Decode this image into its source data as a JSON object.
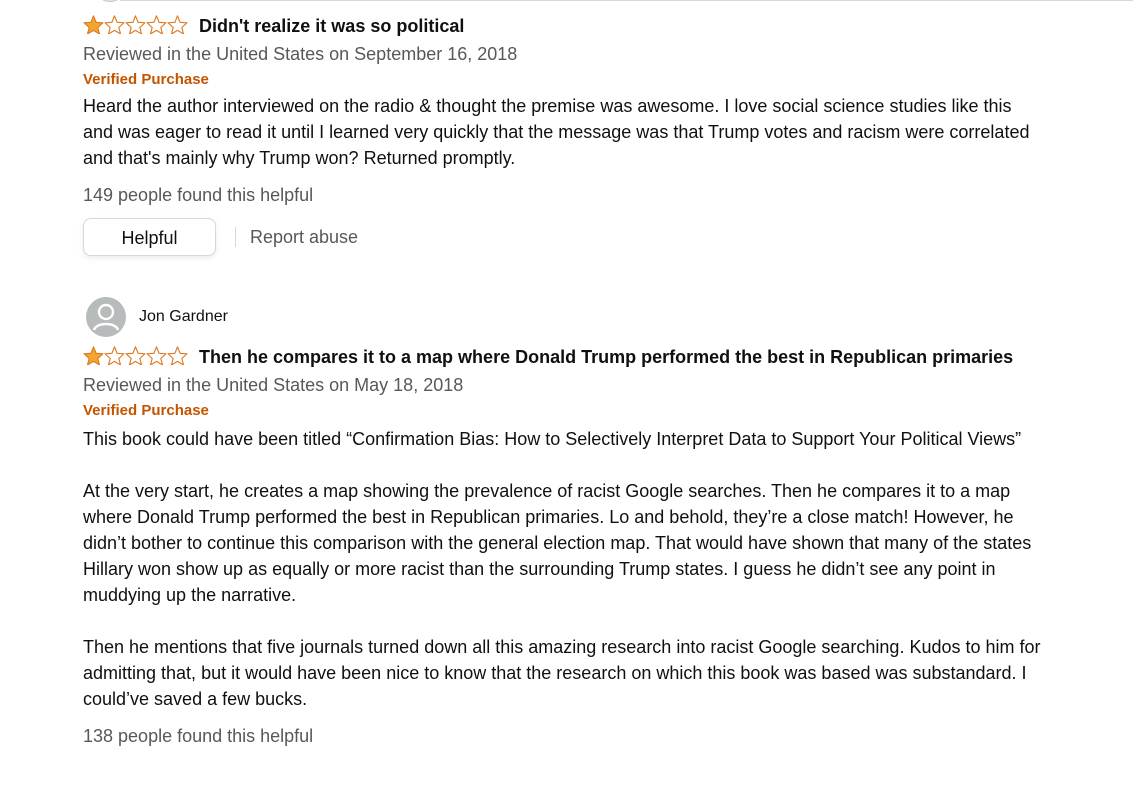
{
  "reviews": [
    {
      "reviewer": "",
      "rating": 1,
      "title": "Didn't realize it was so political",
      "meta": "Reviewed in the United States on September 16, 2018",
      "verified": "Verified Purchase",
      "body": [
        "Heard the author interviewed on the radio & thought the premise was awesome. I love social science studies like this and was eager to read it until I learned very quickly that the message was that Trump votes and racism were correlated and that's mainly why Trump won? Returned promptly."
      ],
      "helpful_count": "149 people found this helpful",
      "helpful_button": "Helpful",
      "report_label": "Report abuse"
    },
    {
      "reviewer": "Jon Gardner",
      "rating": 1,
      "title": "Then he compares it to a map where Donald Trump performed the best in Republican primaries",
      "meta": "Reviewed in the United States on May 18, 2018",
      "verified": "Verified Purchase",
      "body": [
        "This book could have been titled “Confirmation Bias: How to Selectively Interpret Data to Support Your Political Views”",
        "At the very start, he creates a map showing the prevalence of racist Google searches. Then he compares it to a map where Donald Trump performed the best in Republican primaries. Lo and behold, they’re a close match! However, he didn’t bother to continue this comparison with the general election map. That would have shown that many of the states Hillary won show up as equally or more racist than the surrounding Trump states. I guess he didn’t see any point in muddying up the narrative.",
        "Then he mentions that five journals turned down all this amazing research into racist Google searching. Kudos to him for admitting that, but it would have been nice to know that the research on which this book was based was substandard. I could’ve saved a few bucks."
      ],
      "helpful_count": "138 people found this helpful"
    }
  ],
  "colors": {
    "star_fill": "#f1a62d",
    "star_outline": "#de7921",
    "verified": "#c45500",
    "muted": "#565959",
    "text": "#0f1111"
  }
}
